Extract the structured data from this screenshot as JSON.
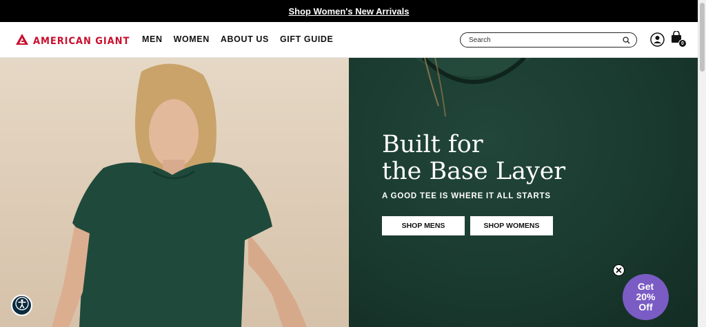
{
  "announcement": {
    "text": "Shop Women's New Arrivals"
  },
  "header": {
    "logo_text": "AMERICAN GIANT",
    "nav": [
      {
        "label": "MEN"
      },
      {
        "label": "WOMEN"
      },
      {
        "label": "ABOUT US"
      },
      {
        "label": "GIFT GUIDE"
      }
    ],
    "search": {
      "placeholder": "Search",
      "value": ""
    },
    "cart_count": "0"
  },
  "hero": {
    "title": "Built for\nthe Base Layer",
    "subtitle": "A GOOD TEE IS WHERE IT ALL STARTS",
    "buttons": {
      "mens": "SHOP MENS",
      "womens": "SHOP WOMENS"
    }
  },
  "promo": {
    "line1": "Get",
    "line2": "20%",
    "line3": "Off"
  },
  "colors": {
    "brand_red": "#c8102e",
    "announcement_bg": "#000000",
    "hero_left_bg": "#dccab4",
    "hero_right_bg": "#1a3a2f",
    "promo_bg": "#7a5cc4",
    "a11y_bg": "#0b2a3d"
  },
  "icons": [
    "logo-mark-icon",
    "search-icon",
    "account-icon",
    "cart-icon",
    "accessibility-icon",
    "close-icon"
  ]
}
